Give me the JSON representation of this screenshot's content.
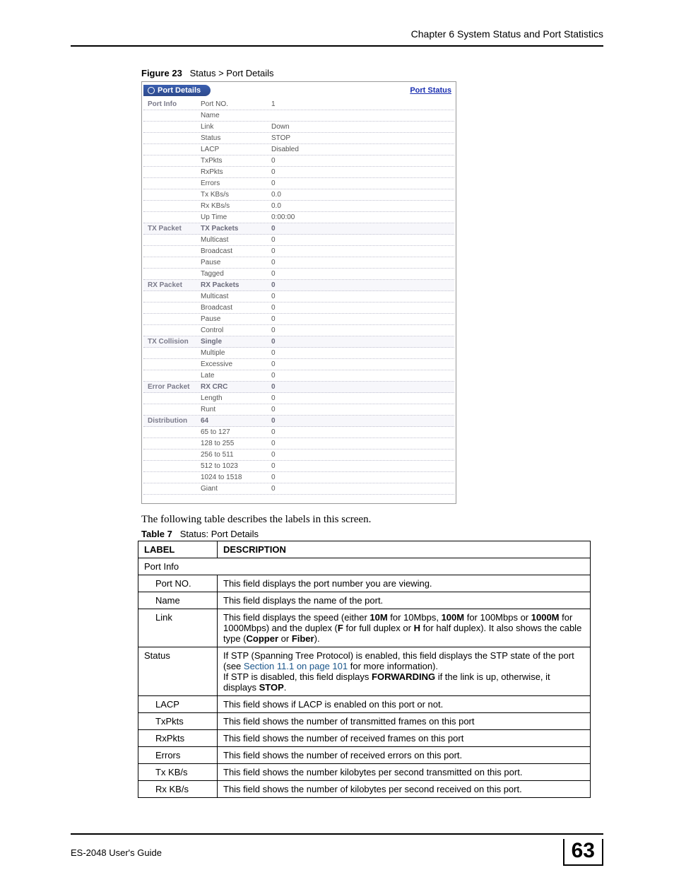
{
  "header": {
    "chapter": "Chapter 6 System Status and Port Statistics"
  },
  "figure": {
    "label": "Figure 23",
    "title": "Status > Port Details"
  },
  "screenshot": {
    "tabTitle": "Port Details",
    "linkText": "Port Status",
    "sections": [
      {
        "group": "Port Info",
        "rows": [
          {
            "k": "Port NO.",
            "v": "1"
          },
          {
            "k": "Name",
            "v": ""
          },
          {
            "k": "Link",
            "v": "Down"
          },
          {
            "k": "Status",
            "v": "STOP"
          },
          {
            "k": "LACP",
            "v": "Disabled"
          },
          {
            "k": "TxPkts",
            "v": "0"
          },
          {
            "k": "RxPkts",
            "v": "0"
          },
          {
            "k": "Errors",
            "v": "0"
          },
          {
            "k": "Tx KBs/s",
            "v": "0.0"
          },
          {
            "k": "Rx KBs/s",
            "v": "0.0"
          },
          {
            "k": "Up Time",
            "v": "0:00:00"
          }
        ]
      },
      {
        "group": "TX Packet",
        "rows": [
          {
            "k": "TX Packets",
            "v": "0",
            "top": true
          },
          {
            "k": "Multicast",
            "v": "0"
          },
          {
            "k": "Broadcast",
            "v": "0"
          },
          {
            "k": "Pause",
            "v": "0"
          },
          {
            "k": "Tagged",
            "v": "0"
          }
        ]
      },
      {
        "group": "RX Packet",
        "rows": [
          {
            "k": "RX Packets",
            "v": "0",
            "top": true
          },
          {
            "k": "Multicast",
            "v": "0"
          },
          {
            "k": "Broadcast",
            "v": "0"
          },
          {
            "k": "Pause",
            "v": "0"
          },
          {
            "k": "Control",
            "v": "0"
          }
        ]
      },
      {
        "group": "TX Collision",
        "rows": [
          {
            "k": "Single",
            "v": "0",
            "top": true
          },
          {
            "k": "Multiple",
            "v": "0"
          },
          {
            "k": "Excessive",
            "v": "0"
          },
          {
            "k": "Late",
            "v": "0"
          }
        ]
      },
      {
        "group": "Error Packet",
        "rows": [
          {
            "k": "RX CRC",
            "v": "0",
            "top": true
          },
          {
            "k": "Length",
            "v": "0"
          },
          {
            "k": "Runt",
            "v": "0"
          }
        ]
      },
      {
        "group": "Distribution",
        "rows": [
          {
            "k": "64",
            "v": "0",
            "top": true
          },
          {
            "k": "65 to 127",
            "v": "0"
          },
          {
            "k": "128 to 255",
            "v": "0"
          },
          {
            "k": "256 to 511",
            "v": "0"
          },
          {
            "k": "512 to 1023",
            "v": "0"
          },
          {
            "k": "1024 to 1518",
            "v": "0"
          },
          {
            "k": "Giant",
            "v": "0"
          }
        ]
      }
    ]
  },
  "paragraph": "The following table describes the labels in this screen.",
  "tableCaption": {
    "label": "Table 7",
    "title": "Status: Port Details"
  },
  "tableHeaders": {
    "col1": "LABEL",
    "col2": "DESCRIPTION"
  },
  "tableRows": [
    {
      "indent": 0,
      "label": "Port Info",
      "desc": "",
      "span": true
    },
    {
      "indent": 1,
      "label": "Port NO.",
      "desc": "This field displays the port number you are viewing."
    },
    {
      "indent": 1,
      "label": "Name",
      "desc": "This field displays the name of the port."
    },
    {
      "indent": 1,
      "label": "Link",
      "desc": "This field displays the speed (either <b>10M</b> for 10Mbps, <b>100M</b> for 100Mbps or <b>1000M</b> for 1000Mbps) and the duplex (<b>F</b> for full duplex or <b>H</b> for half duplex).  It also shows the cable type (<b>Copper</b> or <b>Fiber</b>)."
    },
    {
      "indent": 0,
      "label": "Status",
      "desc": "If STP (Spanning Tree Protocol) is enabled, this field displays the STP state of the port (see <span class='cross-ref'>Section 11.1 on page 101</span> for more information).<br>If STP is disabled, this field displays <b>FORWARDING</b> if the link is up, otherwise, it displays <b>STOP</b>."
    },
    {
      "indent": 1,
      "label": "LACP",
      "desc": "This field shows if LACP is enabled on this port or not."
    },
    {
      "indent": 1,
      "label": "TxPkts",
      "desc": "This field shows the number of transmitted frames on this port"
    },
    {
      "indent": 1,
      "label": "RxPkts",
      "desc": "This field shows the number of received frames on this port"
    },
    {
      "indent": 1,
      "label": "Errors",
      "desc": "This field shows the number of received errors on this port."
    },
    {
      "indent": 1,
      "label": "Tx KB/s",
      "desc": "This field shows the number kilobytes per second transmitted on this port."
    },
    {
      "indent": 1,
      "label": "Rx KB/s",
      "desc": "This field shows the number of kilobytes per second received on this port."
    }
  ],
  "footer": {
    "guide": "ES-2048 User's Guide",
    "page": "63"
  }
}
